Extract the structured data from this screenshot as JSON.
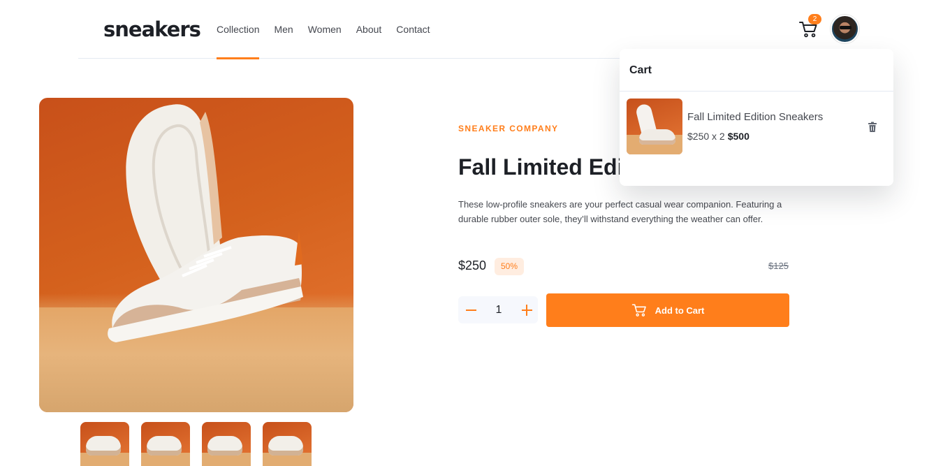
{
  "header": {
    "logo": "sneakers",
    "nav": [
      "Collection",
      "Men",
      "Women",
      "About",
      "Contact"
    ],
    "cart_count": "2"
  },
  "product": {
    "brand": "SNEAKER COMPANY",
    "title": "Fall Limited Edition Sneakers",
    "description": "These low-profile sneakers are your perfect casual wear companion. Featuring a durable rubber outer sole, they’ll withstand everything the weather can offer.",
    "price": "$250",
    "discount": "50%",
    "old_price": "$125",
    "quantity": "1",
    "add_to_cart": "Add to Cart"
  },
  "cart": {
    "title": "Cart",
    "item_name": "Fall Limited Edition Sneakers",
    "item_calc": "$250 x 2",
    "item_total": "$500"
  },
  "colors": {
    "accent": "#ff7e1b",
    "accent_light": "#ffede0",
    "text_dark": "#1d2026",
    "text_gray": "#68707d"
  },
  "icons": [
    "cart-icon",
    "avatar",
    "minus-icon",
    "plus-icon",
    "trash-icon"
  ]
}
